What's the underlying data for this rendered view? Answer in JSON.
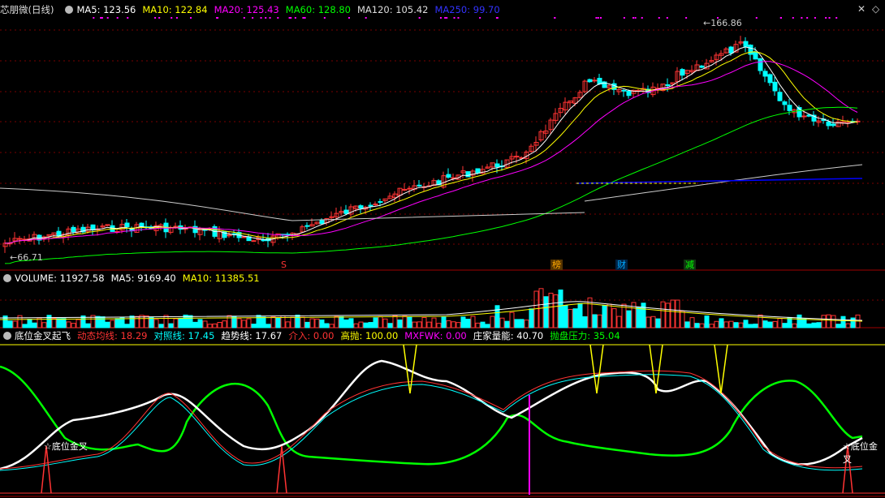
{
  "main": {
    "title": "芯朋微(日线)",
    "ma5": "MA5: 123.56",
    "ma10": "MA10: 122.84",
    "ma20": "MA20: 125.43",
    "ma60": "MA60: 128.80",
    "ma120": "MA120: 105.42",
    "ma250": "MA250: 99.70",
    "high_label": "166.86",
    "low_label": "66.71",
    "signals": {
      "s": "S",
      "bang": "榜",
      "cai": "财",
      "jian": "减"
    },
    "controls": {
      "close": "✕",
      "toggle": "◇"
    }
  },
  "volume": {
    "label": "VOLUME: 11927.58",
    "ma5": "MA5: 9169.40",
    "ma10": "MA10: 11385.51"
  },
  "indicator": {
    "name": "底位金叉起飞",
    "items": [
      {
        "text": "动态均线: 18.29",
        "color": "#ff3333"
      },
      {
        "text": "对照线: 17.45",
        "color": "#00ffff"
      },
      {
        "text": "趋势线: 17.67",
        "color": "#ffffff"
      },
      {
        "text": "介入: 0.00",
        "color": "#ff3333"
      },
      {
        "text": "高抛: 100.00",
        "color": "#ffff00"
      },
      {
        "text": "MXFWK: 0.00",
        "color": "#ff00ff"
      },
      {
        "text": "庄家量能: 40.70",
        "color": "#ffffff"
      },
      {
        "text": "抛盘压力: 35.04",
        "color": "#00ff00"
      }
    ],
    "golden_cross": "☆底位金叉"
  },
  "colors": {
    "up": "#ff3333",
    "down": "#00ffff",
    "ma5": "#ffffff",
    "ma10": "#ffff00",
    "ma20": "#ff00ff",
    "ma60": "#00ff00",
    "ma120": "#cccccc",
    "ma250": "#0000ff"
  }
}
